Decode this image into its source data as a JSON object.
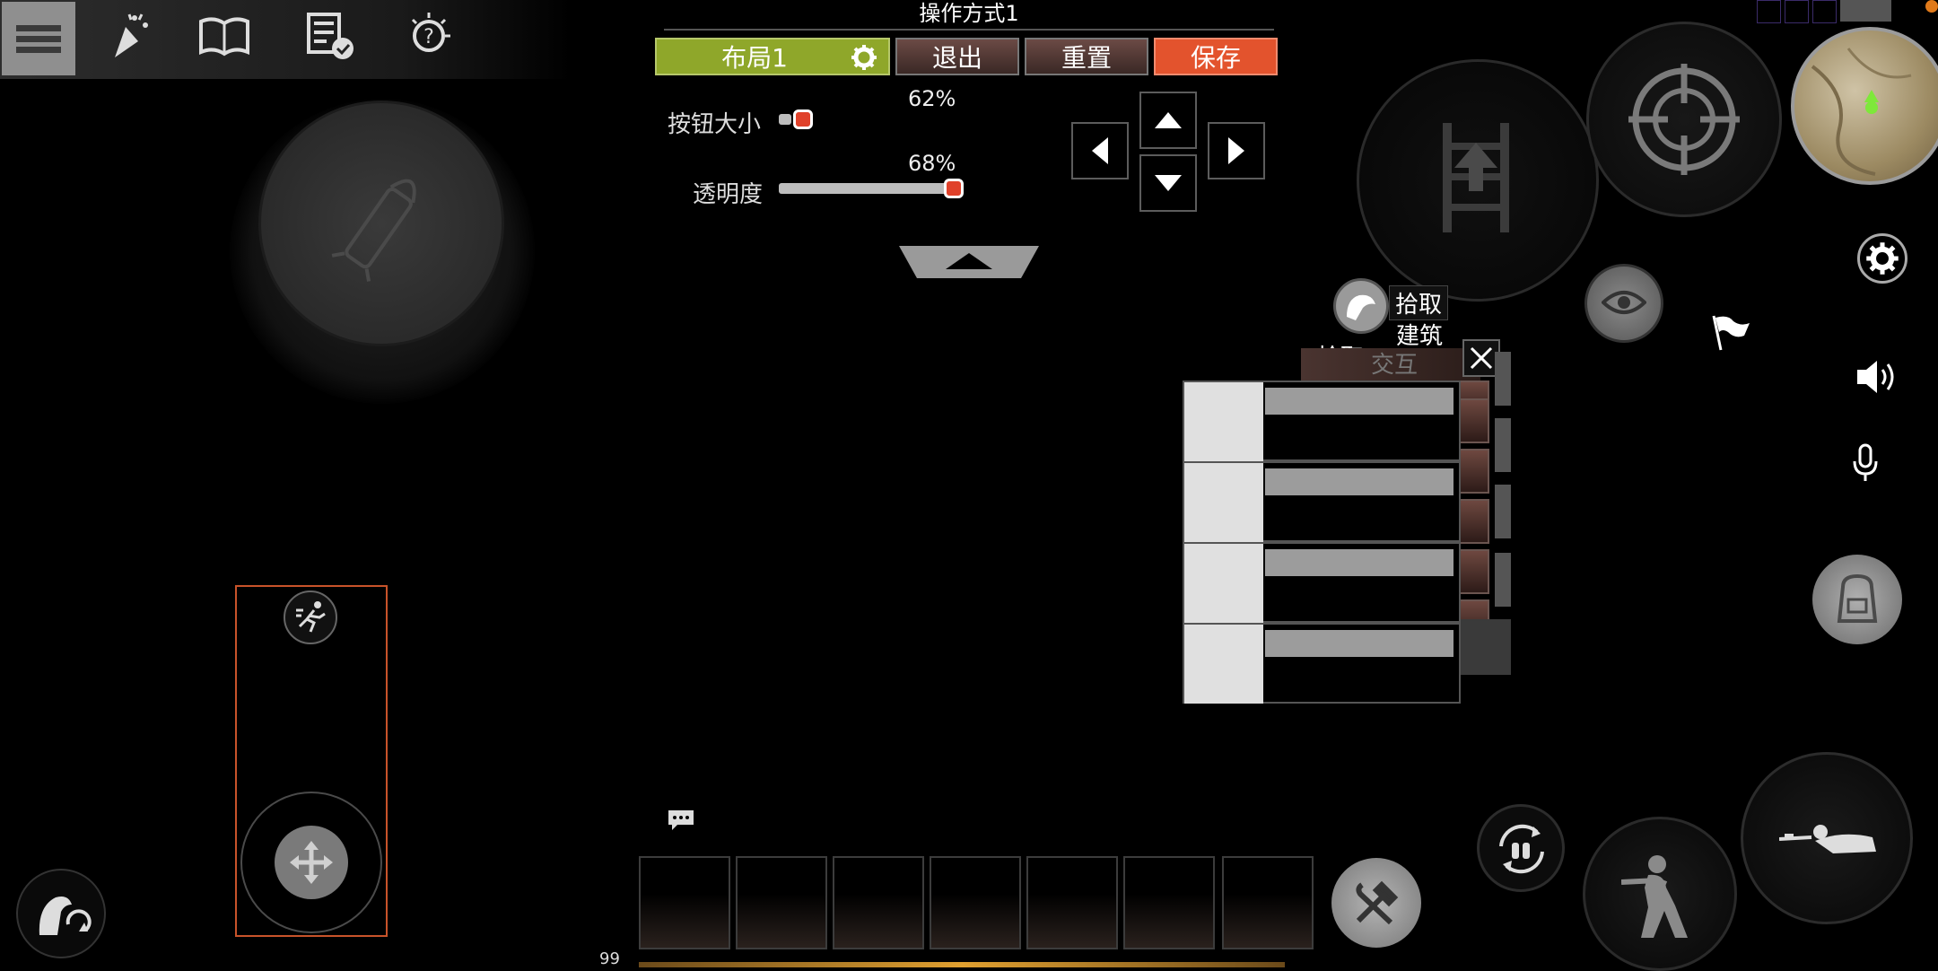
{
  "layout_panel": {
    "title": "操作方式1",
    "layout_label": "布局1",
    "exit_label": "退出",
    "reset_label": "重置",
    "save_label": "保存",
    "button_size_label": "按钮大小",
    "button_size_value": "62%",
    "opacity_label": "透明度",
    "opacity_value": "68%"
  },
  "toolbar": {
    "icons": [
      "menu-icon",
      "celebration-icon",
      "book-icon",
      "task-list-icon",
      "tips-icon"
    ]
  },
  "interaction": {
    "pickup_label": "拾取",
    "build_label": "建筑",
    "pickup_label_2": "拾取",
    "interact_label": "交互"
  },
  "hud": {
    "ammo_count": "99"
  },
  "colors": {
    "accent_green": "#8fa72a",
    "save_red": "#e3532d",
    "joystick_outline": "#c8532a"
  }
}
